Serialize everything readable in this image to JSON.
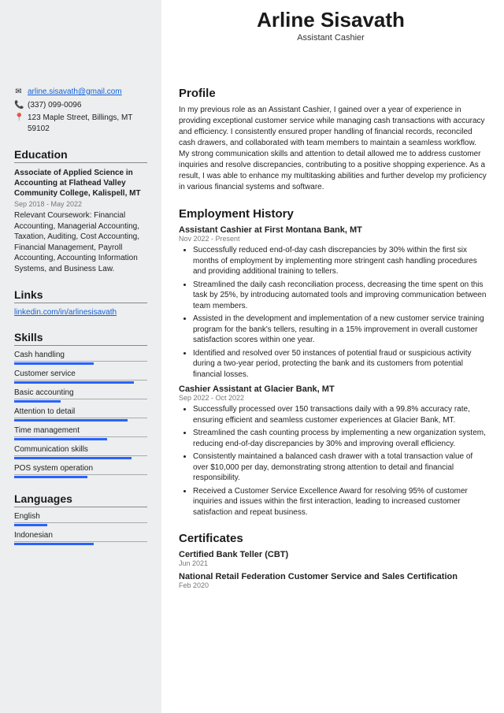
{
  "header": {
    "name": "Arline Sisavath",
    "title": "Assistant Cashier"
  },
  "contact": {
    "email": "arline.sisavath@gmail.com",
    "phone": "(337) 099-0096",
    "address": "123 Maple Street, Billings, MT 59102"
  },
  "education": {
    "heading": "Education",
    "degree": "Associate of Applied Science in Accounting at Flathead Valley Community College, Kalispell, MT",
    "dates": "Sep 2018 - May 2022",
    "coursework": "Relevant Coursework: Financial Accounting, Managerial Accounting, Taxation, Auditing, Cost Accounting, Financial Management, Payroll Accounting, Accounting Information Systems, and Business Law."
  },
  "links": {
    "heading": "Links",
    "url": "linkedin.com/in/arlinesisavath"
  },
  "skills": {
    "heading": "Skills",
    "items": [
      {
        "name": "Cash handling",
        "pct": 60
      },
      {
        "name": "Customer service",
        "pct": 90
      },
      {
        "name": "Basic accounting",
        "pct": 35
      },
      {
        "name": "Attention to detail",
        "pct": 85
      },
      {
        "name": "Time management",
        "pct": 70
      },
      {
        "name": "Communication skills",
        "pct": 88
      },
      {
        "name": "POS system operation",
        "pct": 55
      }
    ]
  },
  "languages": {
    "heading": "Languages",
    "items": [
      {
        "name": "English",
        "pct": 25
      },
      {
        "name": "Indonesian",
        "pct": 60
      }
    ]
  },
  "profile": {
    "heading": "Profile",
    "text": "In my previous role as an Assistant Cashier, I gained over a year of experience in providing exceptional customer service while managing cash transactions with accuracy and efficiency. I consistently ensured proper handling of financial records, reconciled cash drawers, and collaborated with team members to maintain a seamless workflow. My strong communication skills and attention to detail allowed me to address customer inquiries and resolve discrepancies, contributing to a positive shopping experience. As a result, I was able to enhance my multitasking abilities and further develop my proficiency in various financial systems and software."
  },
  "employment": {
    "heading": "Employment History",
    "jobs": [
      {
        "title": "Assistant Cashier at First Montana Bank, MT",
        "dates": "Nov 2022 - Present",
        "bullets": [
          "Successfully reduced end-of-day cash discrepancies by 30% within the first six months of employment by implementing more stringent cash handling procedures and providing additional training to tellers.",
          "Streamlined the daily cash reconciliation process, decreasing the time spent on this task by 25%, by introducing automated tools and improving communication between team members.",
          "Assisted in the development and implementation of a new customer service training program for the bank's tellers, resulting in a 15% improvement in overall customer satisfaction scores within one year.",
          "Identified and resolved over 50 instances of potential fraud or suspicious activity during a two-year period, protecting the bank and its customers from potential financial losses."
        ]
      },
      {
        "title": "Cashier Assistant at Glacier Bank, MT",
        "dates": "Sep 2022 - Oct 2022",
        "bullets": [
          "Successfully processed over 150 transactions daily with a 99.8% accuracy rate, ensuring efficient and seamless customer experiences at Glacier Bank, MT.",
          "Streamlined the cash counting process by implementing a new organization system, reducing end-of-day discrepancies by 30% and improving overall efficiency.",
          "Consistently maintained a balanced cash drawer with a total transaction value of over $10,000 per day, demonstrating strong attention to detail and financial responsibility.",
          "Received a Customer Service Excellence Award for resolving 95% of customer inquiries and issues within the first interaction, leading to increased customer satisfaction and repeat business."
        ]
      }
    ]
  },
  "certificates": {
    "heading": "Certificates",
    "items": [
      {
        "name": "Certified Bank Teller (CBT)",
        "date": "Jun 2021"
      },
      {
        "name": "National Retail Federation Customer Service and Sales Certification",
        "date": "Feb 2020"
      }
    ]
  }
}
